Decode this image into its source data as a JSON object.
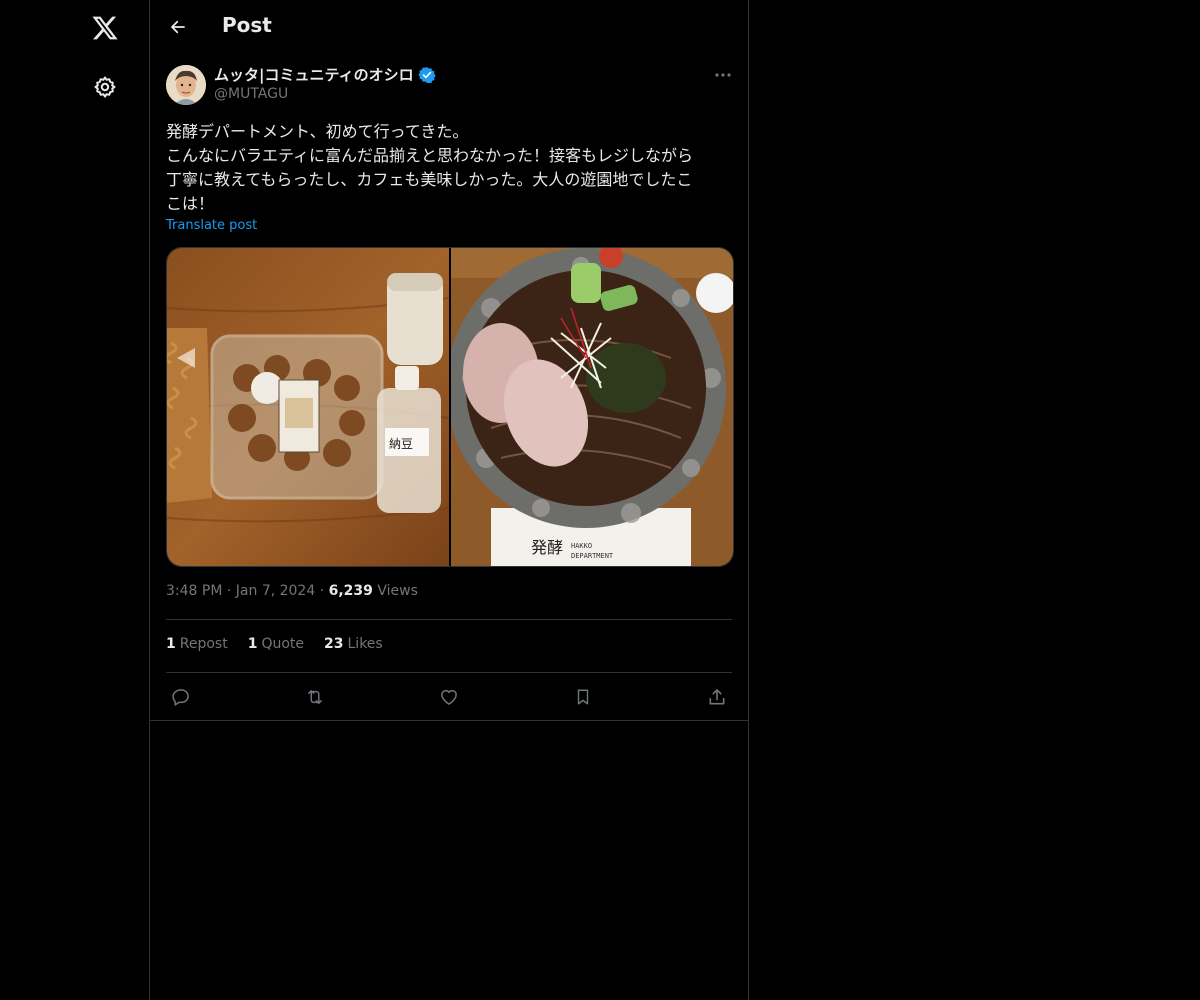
{
  "nav": {
    "logo_icon": "x-logo-icon",
    "settings_icon": "gear-icon"
  },
  "header": {
    "title": "Post"
  },
  "post": {
    "author_name": "ムッタ|コミュニティのオシロ",
    "verified": true,
    "handle": "@MUTAGU",
    "text_lines": [
      "発酵デパートメント、初めて行ってきた。",
      "こんなにバラエティに富んだ品揃えと思わなかった！接客もレジしながら",
      "丁寧に教えてもらったし、カフェも美味しかった。大人の遊園地でしたこ",
      "こは！"
    ],
    "translate_label": "Translate post",
    "images": [
      {
        "alt": "fermented food products on a wooden table"
      },
      {
        "alt": "bowl of soba noodles"
      }
    ],
    "time": "3:48 PM",
    "date": "Jan 7, 2024",
    "views_count": "6,239",
    "views_label": "Views",
    "reposts_count": "1",
    "reposts_label": "Repost",
    "quotes_count": "1",
    "quotes_label": "Quote",
    "likes_count": "23",
    "likes_label": "Likes"
  },
  "colors": {
    "background": "#000000",
    "text": "#e7e9ea",
    "muted": "#71767b",
    "link": "#1d9bf0",
    "border": "#2f3336",
    "verified": "#1d9bf0"
  }
}
